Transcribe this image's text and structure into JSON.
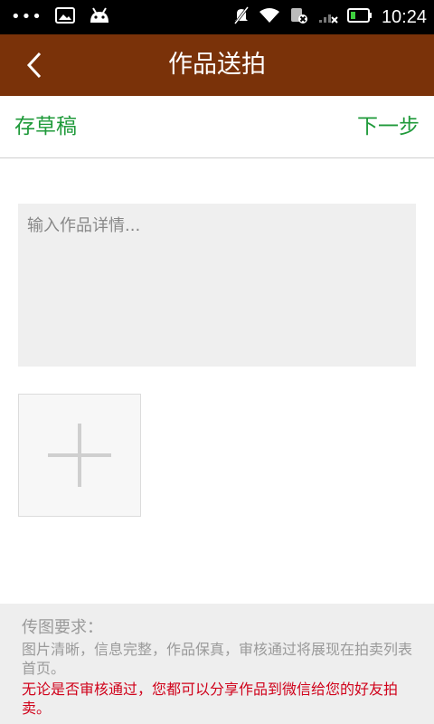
{
  "status_bar": {
    "dots": "•••",
    "time": "10:24"
  },
  "header": {
    "title": "作品送拍",
    "back_icon": "chevron-left-icon"
  },
  "actions": {
    "draft_label": "存草稿",
    "next_label": "下一步"
  },
  "form": {
    "detail_placeholder": "输入作品详情...",
    "detail_value": ""
  },
  "requirements": {
    "title": "传图要求：",
    "text": "图片清晰，信息完整，作品保真，审核通过将展现在拍卖列表首页。",
    "note": "无论是否审核通过，您都可以分享作品到微信给您的好友拍卖。"
  },
  "colors": {
    "header_bg": "#7a3209",
    "action_green": "#1f9a3a",
    "note_red": "#d0021b"
  }
}
